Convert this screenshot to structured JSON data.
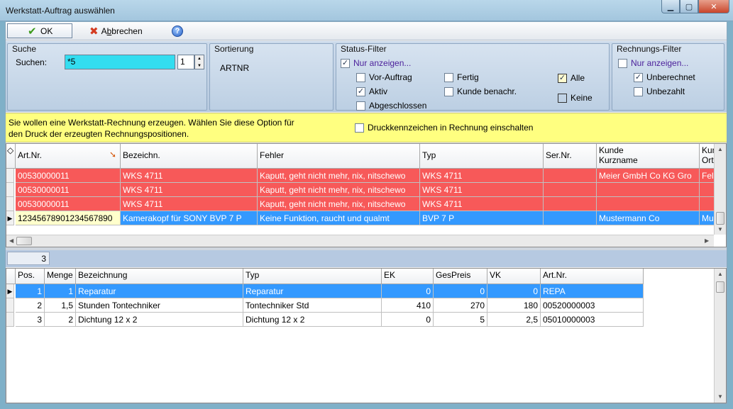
{
  "window": {
    "title": "Werkstatt-Auftrag auswählen",
    "close_glyph": "✕",
    "min_glyph": "▁",
    "max_glyph": "▢"
  },
  "toolbar": {
    "ok_label": "OK",
    "cancel_label_pre": "A",
    "cancel_label_underline": "b",
    "cancel_label_post": "brechen",
    "help_glyph": "?"
  },
  "suche": {
    "title": "Suche",
    "label": "Suchen:",
    "value": "*5",
    "spin_value": "1"
  },
  "sortierung": {
    "title": "Sortierung",
    "value": "ARTNR"
  },
  "status_filter": {
    "title": "Status-Filter",
    "nur_anzeigen": {
      "label": "Nur anzeigen...",
      "checked": true
    },
    "vor_auftrag": {
      "label": "Vor-Auftrag",
      "checked": false
    },
    "aktiv": {
      "label": "Aktiv",
      "checked": true
    },
    "abgeschlossen": {
      "label": "Abgeschlossen",
      "checked": false
    },
    "fertig": {
      "label": "Fertig",
      "checked": false
    },
    "kunde_benachr": {
      "label": "Kunde benachr.",
      "checked": false
    },
    "alle_label": "Alle",
    "keine_label": "Keine"
  },
  "rechnungs_filter": {
    "title": "Rechnungs-Filter",
    "nur_anzeigen": {
      "label": "Nur anzeigen...",
      "checked": false
    },
    "unberechnet": {
      "label": "Unberechnet",
      "checked": true
    },
    "unbezahlt": {
      "label": "Unbezahlt",
      "checked": false
    }
  },
  "info": {
    "line1": "Sie wollen eine Werkstatt-Rechnung erzeugen. Wählen Sie diese Option für",
    "line2": "den Druck der erzeugten Rechnungspositionen.",
    "druck_label": "Druckkennzeichen in Rechnung einschalten",
    "druck_checked": false
  },
  "orders_grid": {
    "headers": {
      "artnr": "Art.Nr.",
      "bezeichn": "Bezeichn.",
      "fehler": "Fehler",
      "typ": "Typ",
      "sernr": "Ser.Nr.",
      "kunde_1": "Kunde",
      "kunde_2": "Kurzname",
      "ku_1": "Kun",
      "ku_2": "Ort"
    },
    "rows": [
      {
        "artnr": "00530000011",
        "bezeichn": "WKS 4711",
        "fehler": "Kaputt, geht nicht mehr, nix, nitschewo",
        "typ": "WKS 4711",
        "sernr": "",
        "kunde": "Meier GmbH  Co KG Gro",
        "ort": "Fel"
      },
      {
        "artnr": "00530000011",
        "bezeichn": "WKS 4711",
        "fehler": "Kaputt, geht nicht mehr, nix, nitschewo",
        "typ": "WKS 4711",
        "sernr": "",
        "kunde": "",
        "ort": ""
      },
      {
        "artnr": "00530000011",
        "bezeichn": "WKS 4711",
        "fehler": "Kaputt, geht nicht mehr, nix, nitschewo",
        "typ": "WKS 4711",
        "sernr": "",
        "kunde": "",
        "ort": ""
      },
      {
        "artnr": "12345678901234567890",
        "bezeichn": "Kamerakopf für SONY BVP 7 P",
        "fehler": "Keine Funktion, raucht und qualmt",
        "typ": "BVP 7 P",
        "sernr": "",
        "kunde": "Mustermann  Co",
        "ort": "Mu"
      }
    ]
  },
  "count": "3",
  "positions_grid": {
    "headers": {
      "pos": "Pos.",
      "menge": "Menge",
      "bezeichnung": "Bezeichnung",
      "typ": "Typ",
      "ek": "EK",
      "gespreis": "GesPreis",
      "vk": "VK",
      "artnr": "Art.Nr."
    },
    "rows": [
      {
        "pos": "1",
        "menge": "1",
        "bezeichnung": "Reparatur",
        "typ": "Reparatur",
        "ek": "0",
        "gespreis": "0",
        "vk": "0",
        "artnr": "REPA"
      },
      {
        "pos": "2",
        "menge": "1,5",
        "bezeichnung": "Stunden Tontechniker",
        "typ": "Tontechniker Std",
        "ek": "410",
        "gespreis": "270",
        "vk": "180",
        "artnr": "00520000003"
      },
      {
        "pos": "3",
        "menge": "2",
        "bezeichnung": "Dichtung 12 x 2",
        "typ": "Dichtung 12 x 2",
        "ek": "0",
        "gespreis": "5",
        "vk": "2,5",
        "artnr": "05010000003"
      }
    ]
  },
  "colors": {
    "row_red": "#f75959",
    "row_selected": "#3399ff",
    "search_bg": "#33ddf0",
    "info_bg": "#ffff80"
  }
}
